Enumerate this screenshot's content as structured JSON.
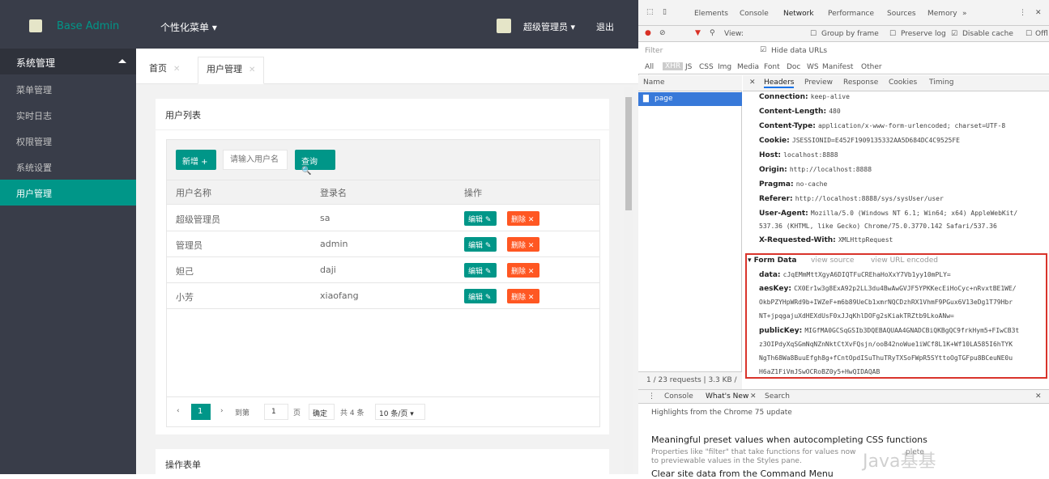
{
  "app": {
    "brand": "Base Admin",
    "personal_menu": "个性化菜单 ▾",
    "user_name": "超级管理员 ▾",
    "logout": "退出",
    "sidebar": {
      "group": "系统管理",
      "items": [
        "菜单管理",
        "实时日志",
        "权限管理",
        "系统设置",
        "用户管理"
      ]
    },
    "tabs": [
      {
        "label": "首页"
      },
      {
        "label": "用户管理"
      }
    ],
    "card_title": "用户列表",
    "add_button": "新增 +",
    "search_placeholder": "请输入用户名",
    "search_button": "查询 🔍",
    "columns": [
      "用户名称",
      "登录名",
      "操作"
    ],
    "rows": [
      {
        "name": "超级管理员",
        "login": "sa"
      },
      {
        "name": "管理员",
        "login": "admin"
      },
      {
        "name": "妲己",
        "login": "daji"
      },
      {
        "name": "小芳",
        "login": "xiaofang"
      }
    ],
    "edit_label": "编辑 ✎",
    "delete_label": "删除 ✕",
    "pager": {
      "current": "1",
      "goto_label": "到第",
      "page_input": "1",
      "page_suffix": "页",
      "confirm": "确定",
      "total": "共 4 条",
      "size": "10 条/页 ▾"
    },
    "card2_title": "操作表单"
  },
  "devtools": {
    "tabs": [
      "Elements",
      "Console",
      "Network",
      "Performance",
      "Sources",
      "Memory",
      "»"
    ],
    "toolbar": {
      "view": "View:",
      "group_by_frame": "Group by frame",
      "preserve_log": "Preserve log",
      "disable_cache": "Disable cache",
      "offline": "Offl"
    },
    "filter_placeholder": "Filter",
    "hide_data_urls": "Hide data URLs",
    "types": [
      "All",
      "XHR",
      "JS",
      "CSS",
      "Img",
      "Media",
      "Font",
      "Doc",
      "WS",
      "Manifest",
      "Other"
    ],
    "name_header": "Name",
    "request_name": "page",
    "detail_tabs": [
      "Headers",
      "Preview",
      "Response",
      "Cookies",
      "Timing"
    ],
    "headers": [
      {
        "k": "Connection:",
        "v": "keep-alive"
      },
      {
        "k": "Content-Length:",
        "v": "480"
      },
      {
        "k": "Content-Type:",
        "v": "application/x-www-form-urlencoded; charset=UTF-8"
      },
      {
        "k": "Cookie:",
        "v": "JSESSIONID=E452F1909135332AA5D684DC4C9525FE"
      },
      {
        "k": "Host:",
        "v": "localhost:8888"
      },
      {
        "k": "Origin:",
        "v": "http://localhost:8888"
      },
      {
        "k": "Pragma:",
        "v": "no-cache"
      },
      {
        "k": "Referer:",
        "v": "http://localhost:8888/sys/sysUser/user"
      },
      {
        "k": "User-Agent:",
        "v": "Mozilla/5.0 (Windows NT 6.1; Win64; x64) AppleWebKit/"
      },
      {
        "k": "",
        "v": "537.36 (KHTML, like Gecko) Chrome/75.0.3770.142 Safari/537.36"
      },
      {
        "k": "X-Requested-With:",
        "v": "XMLHttpRequest"
      }
    ],
    "form_data_title": "▾ Form Data",
    "view_source": "view source",
    "view_url_encoded": "view URL encoded",
    "form_lines": [
      {
        "k": "data:",
        "v": "cJqEMmMttXgyA6DIQTFuCREhaHoXxY7Vb1yy10mPLY="
      },
      {
        "k": "aesKey:",
        "v": "CX0Er1w3g8ExA92p2LL3du4BwAwGVJF5YPKKecEiHoCyc+nRvxtBE1WE/"
      },
      {
        "k": "",
        "v": "OkbPZYHpWRd9b+IWZeF+m6b89UeCb1xmrNQCDzhRX1VhmF9PGux6V13eDg1T79Hbr"
      },
      {
        "k": "",
        "v": "NT+jpqgajuXdHEXdUsF0xJJqKhlDOFg2sKiakTRZtb9LkoANw="
      },
      {
        "k": "publicKey:",
        "v": "MIGfMA0GCSqGSIb3DQEBAQUAA4GNADCBiQKBgQC9frkHym5+FIwCB3t"
      },
      {
        "k": "",
        "v": "z3OIPdyXqSGmNqNZnNktCtXvFQsjn/ooB42noWue1iWCf8L1K+Wf10LA585I6hTYK"
      },
      {
        "k": "",
        "v": "NgTh68Wa8BuuEfgh8g+fCntOpdISuThuTRyTXSoFWpR5SYttoOgTGFpu8BCeuNE0u"
      },
      {
        "k": "",
        "v": "H6aZ1FiVmJSwOCRoBZ0y5+HwQIDAQAB"
      }
    ],
    "status": "1 / 23 requests | 3.3 KB /",
    "drawer_tabs": [
      "Console",
      "What's New",
      "Search"
    ],
    "highlights": "Highlights from the Chrome 75 update",
    "news_title": "Meaningful preset values when autocompleting CSS functions",
    "news_body1": "Properties like \"filter\" that take functions for values now",
    "news_body1b": "plete",
    "news_body2": "to previewable values in the Styles pane.",
    "news_title2": "Clear site data from the Command Menu",
    "watermark": "Java基基"
  }
}
